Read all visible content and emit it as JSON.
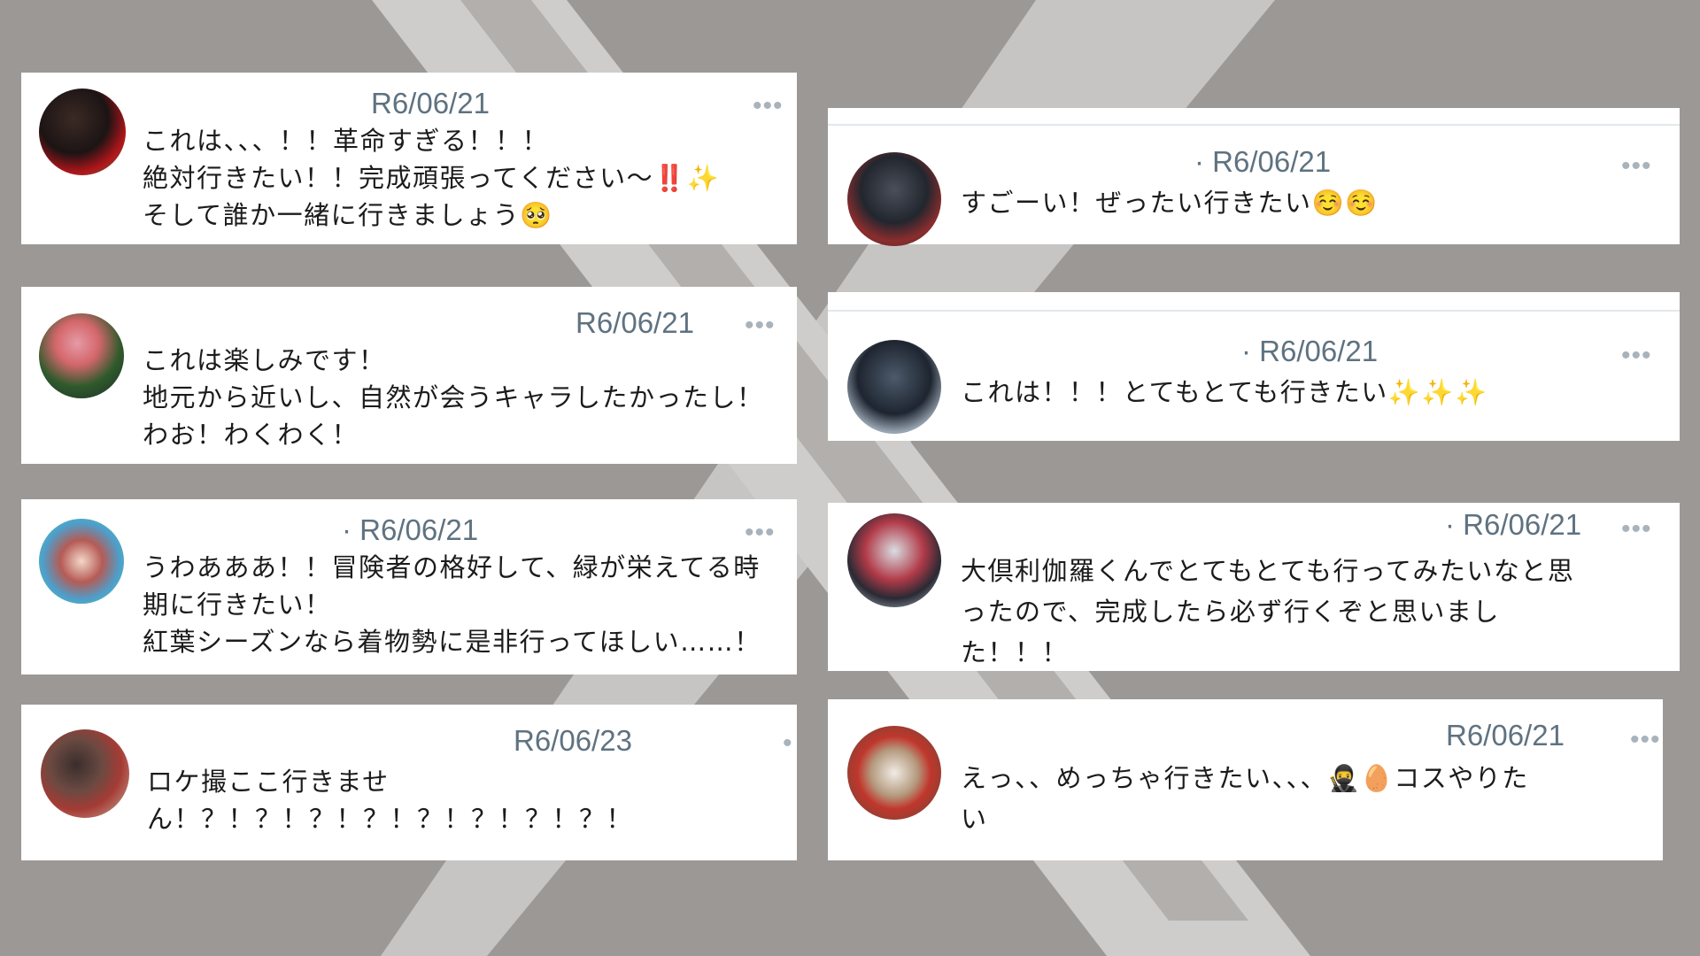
{
  "colors": {
    "background": "#9b9896",
    "x_logo": "#cfcdcb",
    "card": "#ffffff",
    "date_text": "#5f7280",
    "body_text": "#1b1b1b",
    "more_dots": "#a8b3bc"
  },
  "more_icon": "more-dots-icon",
  "cards": [
    {
      "date": "R6/06/21",
      "lines": [
        "これは、、、！！革命すぎる！！！",
        "絶対行きたい！！完成頑張ってください〜‼️✨",
        "そして誰か一緒に行きましょう🥺"
      ]
    },
    {
      "date": "R6/06/21",
      "lines": [
        "これは楽しみです！",
        "地元から近いし、自然が会うキャラしたかったし！",
        "わお！わくわく！"
      ]
    },
    {
      "date": "· R6/06/21",
      "lines": [
        "うわあああ！！冒険者の格好して、緑が栄えてる時",
        "期に行きたい！",
        "紅葉シーズンなら着物勢に是非行ってほしい……！"
      ]
    },
    {
      "date": "R6/06/23",
      "lines": [
        "ロケ撮ここ行きませ",
        "ん！？！？！？！？！？！？！？！？！"
      ]
    },
    {
      "date": "· R6/06/21",
      "lines": [
        "すごーい！ぜったい行きたい☺️☺️"
      ]
    },
    {
      "date": "· R6/06/21",
      "lines": [
        "これは！！！とてもとても行きたい✨✨✨"
      ]
    },
    {
      "date": "· R6/06/21",
      "lines": [
        "大倶利伽羅くんでとてもとても行ってみたいなと思",
        "ったので、完成したら必ず行くぞと思いまし",
        "た！！！"
      ]
    },
    {
      "date": "R6/06/21",
      "lines": [
        "えっ、、めっちゃ行きたい、、、🥷🥚コスやりた",
        "い"
      ]
    }
  ]
}
